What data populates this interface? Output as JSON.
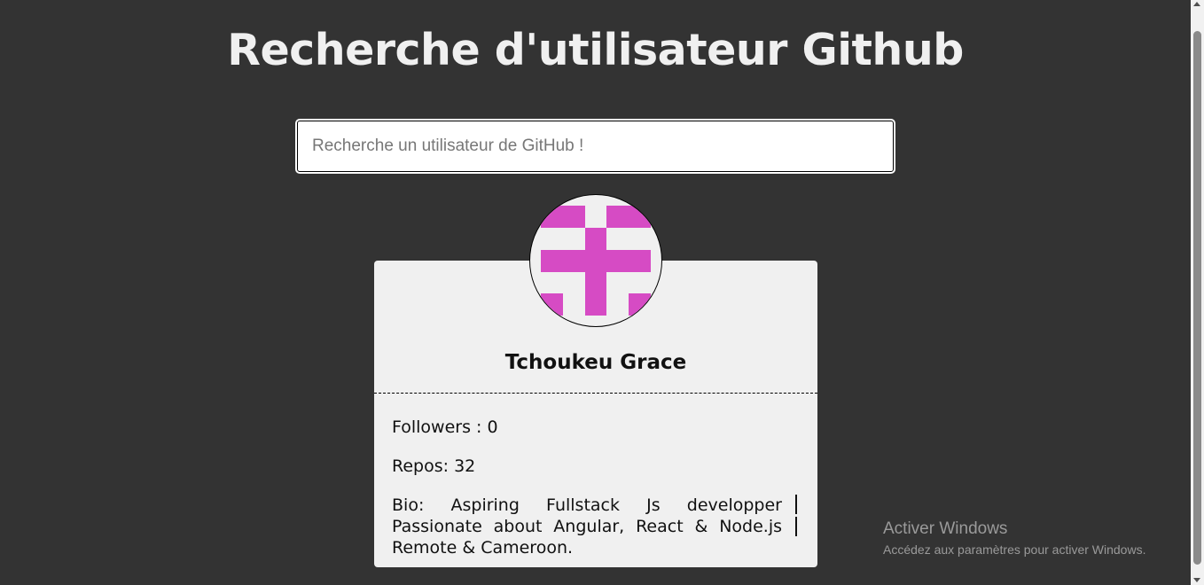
{
  "header": {
    "title": "Recherche d'utilisateur Github"
  },
  "search": {
    "placeholder": "Recherche un utilisateur de GitHub !",
    "value": ""
  },
  "profile": {
    "avatar_color": "#d64bc4",
    "name": "Tchoukeu Grace",
    "followers": "Followers : 0",
    "repos": "Repos: 32",
    "bio": "Bio: Aspiring Fullstack Js developper Passionate about Angular, React & Node.js Remote & Cameroon."
  },
  "os_watermark": {
    "title": "Activer Windows",
    "subtitle": "Accédez aux paramètres pour activer Windows."
  },
  "colors": {
    "background": "#333333",
    "card": "#f0f0f0",
    "title": "#f0f0f0"
  }
}
